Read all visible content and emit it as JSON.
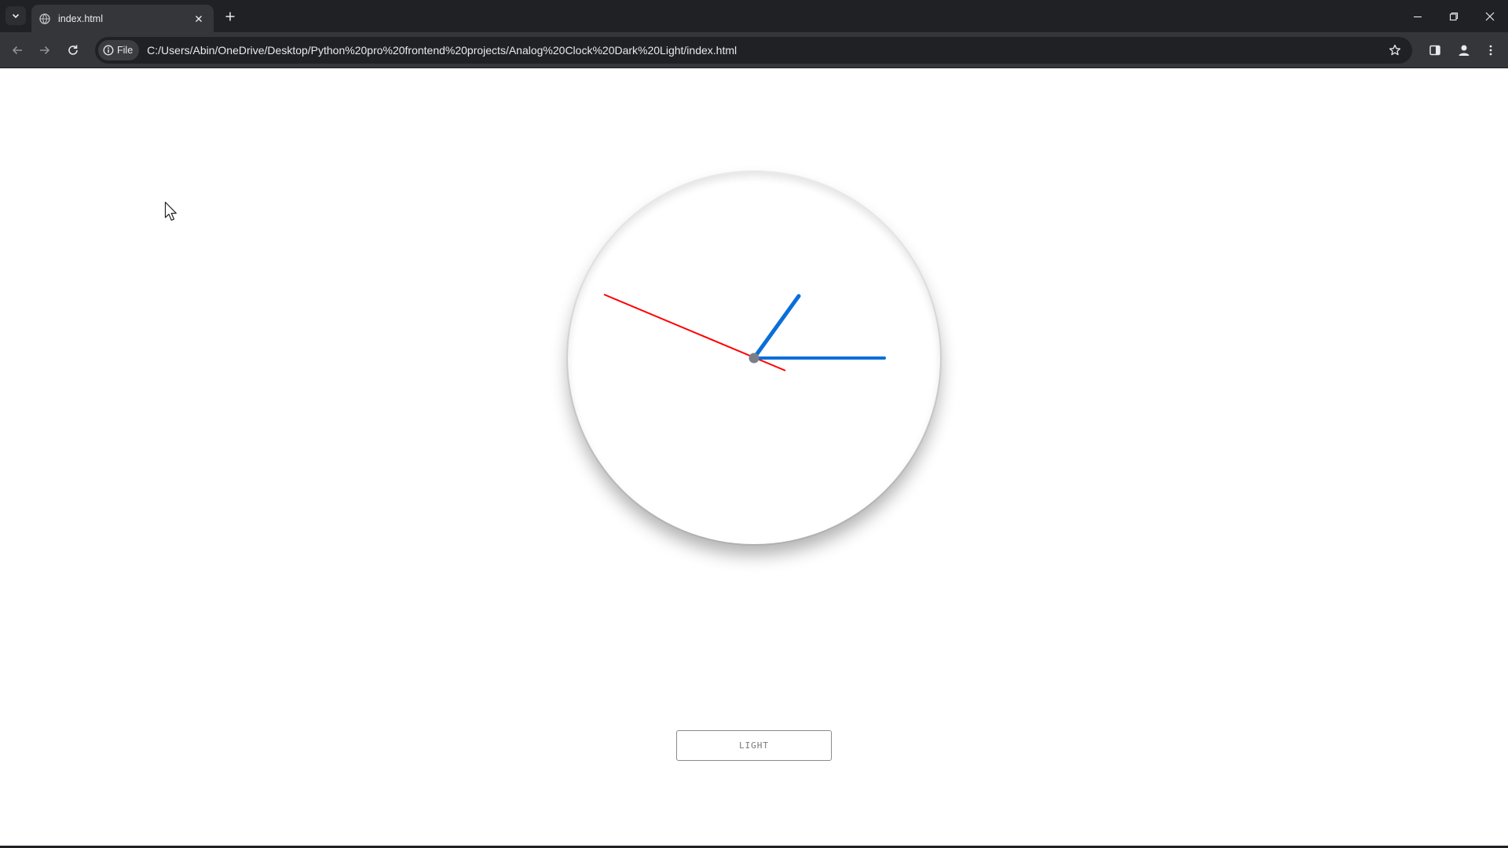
{
  "browser": {
    "tab_title": "index.html",
    "url_chip": "File",
    "url": "C:/Users/Abin/OneDrive/Desktop/Python%20pro%20frontend%20projects/Analog%20Clock%20Dark%20Light/index.html"
  },
  "clock": {
    "hour_hand_color": "#0a6fd8",
    "minute_hand_color": "#0a6fd8",
    "second_hand_color": "#ff0000",
    "center_color": "#7a7f86"
  },
  "toggle": {
    "label": "LIGHT"
  },
  "colors": {
    "chrome_dark": "#202124",
    "chrome_mid": "#35363a",
    "page_bg": "#ffffff"
  }
}
